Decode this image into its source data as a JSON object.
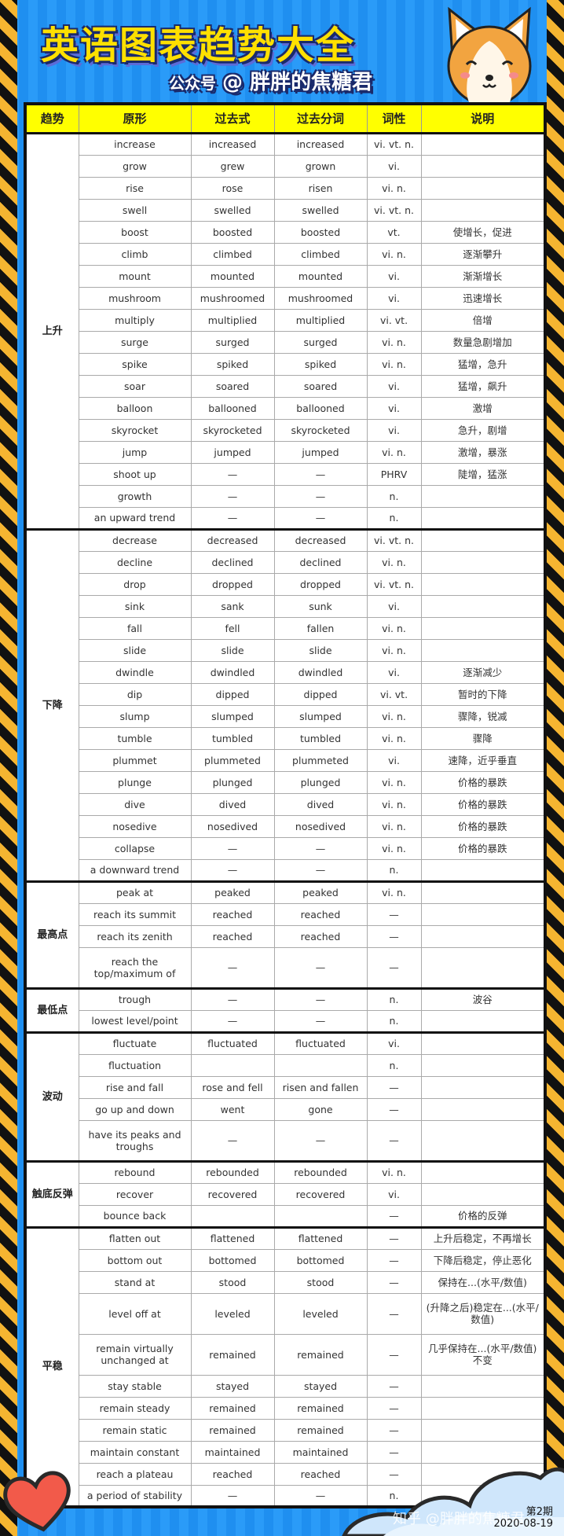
{
  "header": {
    "title": "英语图表趋势大全",
    "account_prefix": "公众号",
    "account_at": "@",
    "account_name": "胖胖的焦糖君"
  },
  "columns": [
    "趋势",
    "原形",
    "过去式",
    "过去分词",
    "词性",
    "说明"
  ],
  "sections": [
    {
      "trend": "上升",
      "rows": [
        [
          "increase",
          "increased",
          "increased",
          "vi. vt. n.",
          ""
        ],
        [
          "grow",
          "grew",
          "grown",
          "vi.",
          ""
        ],
        [
          "rise",
          "rose",
          "risen",
          "vi. n.",
          ""
        ],
        [
          "swell",
          "swelled",
          "swelled",
          "vi. vt. n.",
          ""
        ],
        [
          "boost",
          "boosted",
          "boosted",
          "vt.",
          "使增长，促进"
        ],
        [
          "climb",
          "climbed",
          "climbed",
          "vi. n.",
          "逐渐攀升"
        ],
        [
          "mount",
          "mounted",
          "mounted",
          "vi.",
          "渐渐增长"
        ],
        [
          "mushroom",
          "mushroomed",
          "mushroomed",
          "vi.",
          "迅速增长"
        ],
        [
          "multiply",
          "multiplied",
          "multiplied",
          "vi. vt.",
          "倍增"
        ],
        [
          "surge",
          "surged",
          "surged",
          "vi. n.",
          "数量急剧增加"
        ],
        [
          "spike",
          "spiked",
          "spiked",
          "vi. n.",
          "猛增，急升"
        ],
        [
          "soar",
          "soared",
          "soared",
          "vi.",
          "猛增，飙升"
        ],
        [
          "balloon",
          "ballooned",
          "ballooned",
          "vi.",
          "激增"
        ],
        [
          "skyrocket",
          "skyrocketed",
          "skyrocketed",
          "vi.",
          "急升，剧增"
        ],
        [
          "jump",
          "jumped",
          "jumped",
          "vi. n.",
          "激增，暴涨"
        ],
        [
          "shoot up",
          "—",
          "—",
          "PHRV",
          "陡增，猛涨"
        ],
        [
          "growth",
          "—",
          "—",
          "n.",
          ""
        ],
        [
          "an upward trend",
          "—",
          "—",
          "n.",
          ""
        ]
      ]
    },
    {
      "trend": "下降",
      "rows": [
        [
          "decrease",
          "decreased",
          "decreased",
          "vi. vt. n.",
          ""
        ],
        [
          "decline",
          "declined",
          "declined",
          "vi. n.",
          ""
        ],
        [
          "drop",
          "dropped",
          "dropped",
          "vi. vt. n.",
          ""
        ],
        [
          "sink",
          "sank",
          "sunk",
          "vi.",
          ""
        ],
        [
          "fall",
          "fell",
          "fallen",
          "vi. n.",
          ""
        ],
        [
          "slide",
          "slide",
          "slide",
          "vi. n.",
          ""
        ],
        [
          "dwindle",
          "dwindled",
          "dwindled",
          "vi.",
          "逐渐减少"
        ],
        [
          "dip",
          "dipped",
          "dipped",
          "vi. vt.",
          "暂时的下降"
        ],
        [
          "slump",
          "slumped",
          "slumped",
          "vi. n.",
          "骤降，锐减"
        ],
        [
          "tumble",
          "tumbled",
          "tumbled",
          "vi. n.",
          "骤降"
        ],
        [
          "plummet",
          "plummeted",
          "plummeted",
          "vi.",
          "速降，近乎垂直"
        ],
        [
          "plunge",
          "plunged",
          "plunged",
          "vi. n.",
          "价格的暴跌"
        ],
        [
          "dive",
          "dived",
          "dived",
          "vi. n.",
          "价格的暴跌"
        ],
        [
          "nosedive",
          "nosedived",
          "nosedived",
          "vi. n.",
          "价格的暴跌"
        ],
        [
          "collapse",
          "—",
          "—",
          "vi. n.",
          "价格的暴跌"
        ],
        [
          "a downward trend",
          "—",
          "—",
          "n.",
          ""
        ]
      ]
    },
    {
      "trend": "最高点",
      "rows": [
        [
          "peak at",
          "peaked",
          "peaked",
          "vi. n.",
          ""
        ],
        [
          "reach its summit",
          "reached",
          "reached",
          "—",
          ""
        ],
        [
          "reach its zenith",
          "reached",
          "reached",
          "—",
          ""
        ],
        [
          "reach the top/maximum of",
          "—",
          "—",
          "—",
          ""
        ]
      ]
    },
    {
      "trend": "最低点",
      "rows": [
        [
          "trough",
          "—",
          "—",
          "n.",
          "波谷"
        ],
        [
          "lowest level/point",
          "—",
          "—",
          "n.",
          ""
        ]
      ]
    },
    {
      "trend": "波动",
      "rows": [
        [
          "fluctuate",
          "fluctuated",
          "fluctuated",
          "vi.",
          ""
        ],
        [
          "fluctuation",
          "",
          "",
          "n.",
          ""
        ],
        [
          "rise and fall",
          "rose and fell",
          "risen and fallen",
          "—",
          ""
        ],
        [
          "go up and down",
          "went",
          "gone",
          "—",
          ""
        ],
        [
          "have its peaks and troughs",
          "—",
          "—",
          "—",
          ""
        ]
      ]
    },
    {
      "trend": "触底反弹",
      "rows": [
        [
          "rebound",
          "rebounded",
          "rebounded",
          "vi. n.",
          ""
        ],
        [
          "recover",
          "recovered",
          "recovered",
          "vi.",
          ""
        ],
        [
          "bounce back",
          "",
          "",
          "—",
          "价格的反弹"
        ]
      ]
    },
    {
      "trend": "平稳",
      "rows": [
        [
          "flatten out",
          "flattened",
          "flattened",
          "—",
          "上升后稳定，不再增长"
        ],
        [
          "bottom out",
          "bottomed",
          "bottomed",
          "—",
          "下降后稳定，停止恶化"
        ],
        [
          "stand at",
          "stood",
          "stood",
          "—",
          "保持在...(水平/数值)"
        ],
        [
          "level off at",
          "leveled",
          "leveled",
          "—",
          "(升降之后)稳定在...(水平/数值)"
        ],
        [
          "remain virtually unchanged at",
          "remained",
          "remained",
          "—",
          "几乎保持在...(水平/数值)不变"
        ],
        [
          "stay stable",
          "stayed",
          "stayed",
          "—",
          ""
        ],
        [
          "remain steady",
          "remained",
          "remained",
          "—",
          ""
        ],
        [
          "remain static",
          "remained",
          "remained",
          "—",
          ""
        ],
        [
          "maintain constant",
          "maintained",
          "maintained",
          "—",
          ""
        ],
        [
          "reach a plateau",
          "reached",
          "reached",
          "—",
          ""
        ],
        [
          "a period of stability",
          "—",
          "—",
          "n.",
          ""
        ]
      ]
    }
  ],
  "footer": {
    "watermark": "知乎 @胖胖的焦糖君",
    "issue": "第2期",
    "date": "2020-08-19"
  },
  "colors": {
    "header_bg": "#ffff00",
    "page_bg": "#1f8ff0",
    "title": "#ffe000",
    "hazard": "#f5b531"
  }
}
